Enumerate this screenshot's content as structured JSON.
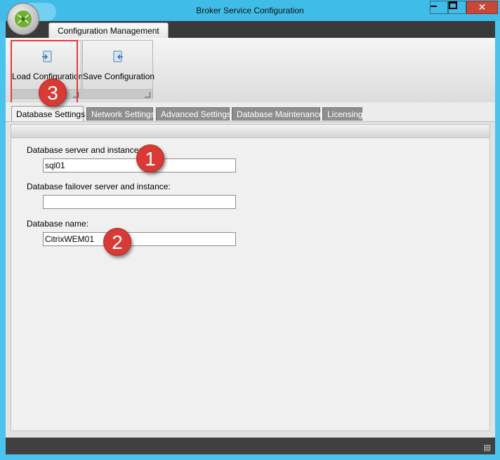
{
  "window": {
    "title": "Broker Service Configuration",
    "close_glyph": "✕"
  },
  "ribbon": {
    "tab_label": "Configuration Management",
    "buttons": [
      {
        "label": "Load Configuration",
        "icon": "load-config-icon"
      },
      {
        "label": "Save Configuration",
        "icon": "save-config-icon"
      }
    ]
  },
  "tabs": [
    {
      "label": "Database Settings",
      "active": true
    },
    {
      "label": "Network Settings",
      "active": false
    },
    {
      "label": "Advanced Settings",
      "active": false
    },
    {
      "label": "Database Maintenance",
      "active": false
    },
    {
      "label": "Licensing",
      "active": false
    }
  ],
  "database_settings": {
    "server_label": "Database server and instance:",
    "server_value": "sql01",
    "failover_label": "Database failover server and instance:",
    "failover_value": "",
    "name_label": "Database name:",
    "name_value": "CitrixWEM01"
  },
  "annotations": [
    "1",
    "2",
    "3"
  ],
  "colors": {
    "window_chrome": "#3fbde8",
    "close_button": "#c7473b",
    "annotation_red": "#d83a35",
    "active_tab": "#f2f2f2",
    "inactive_tab": "#8e8e8e"
  }
}
